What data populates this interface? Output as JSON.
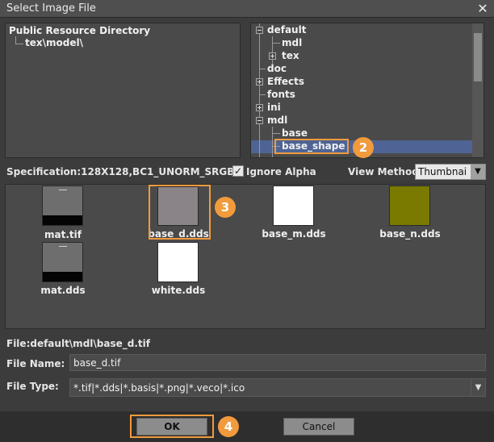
{
  "window": {
    "title": "Select Image File",
    "close_glyph": "✕"
  },
  "left_tree": {
    "root": "Public Resource Directory",
    "child": "tex\\model\\"
  },
  "right_tree": {
    "items": [
      {
        "label": "default"
      },
      {
        "label": "mdl"
      },
      {
        "label": "tex"
      },
      {
        "label": "doc"
      },
      {
        "label": "Effects"
      },
      {
        "label": "fonts"
      },
      {
        "label": "ini"
      },
      {
        "label": "mdl"
      },
      {
        "label": "base"
      },
      {
        "label": "base_shape"
      }
    ],
    "selected": "base_shape"
  },
  "specification": "Specification:128X128,BC1_UNORM_SRGB",
  "ignore_alpha": {
    "label": "Ignore Alpha",
    "checked": true,
    "check_glyph": "✓"
  },
  "view_method": {
    "label": "View Method:",
    "value": "Thumbnai",
    "arrow": "▼"
  },
  "files": [
    {
      "name": "mat.tif",
      "thumb": "mat-preview"
    },
    {
      "name": "base_d.dds",
      "thumb": "grey",
      "selected": true
    },
    {
      "name": "base_m.dds",
      "thumb": "white"
    },
    {
      "name": "base_n.dds",
      "thumb": "olive"
    },
    {
      "name": "mat.dds",
      "thumb": "mat-preview"
    },
    {
      "name": "white.dds",
      "thumb": "white"
    }
  ],
  "file_path": "File:default\\mdl\\base_d.tif",
  "file_name": {
    "label": "File Name:",
    "value": "base_d.tif"
  },
  "file_type": {
    "label": "File Type:",
    "value": "*.tif|*.dds|*.basis|*.png|*.veco|*.ico",
    "arrow": "▼"
  },
  "buttons": {
    "ok": "OK",
    "cancel": "Cancel"
  },
  "callouts": {
    "step2": "2",
    "step3": "3",
    "step4": "4"
  },
  "colors": {
    "accent": "#f29b3c",
    "selection": "#4f6494",
    "olive": "#7a7a00",
    "grey_thumb": "#8a8488"
  }
}
